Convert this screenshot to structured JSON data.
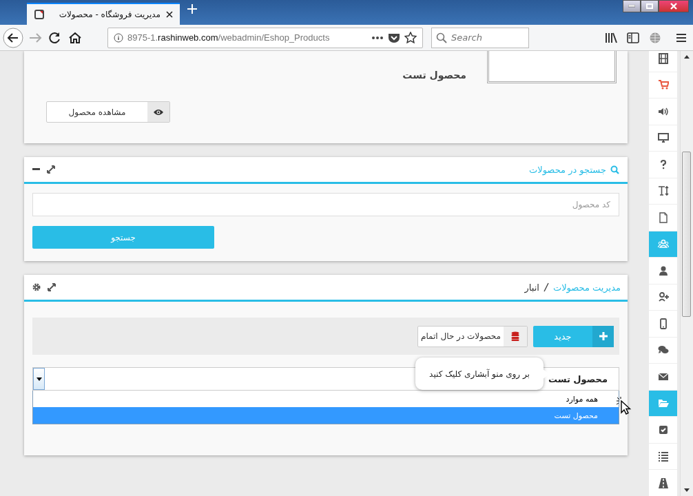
{
  "browser": {
    "tab_title": "مدیریت فروشگاه - محصولات",
    "url_host": "8975-1.",
    "url_domain": "rashinweb.com",
    "url_path": "/webadmin/Eshop_Products",
    "search_placeholder": "Search"
  },
  "product_panel": {
    "product_name": "محصول تست",
    "view_button": "مشاهده محصول"
  },
  "search_panel": {
    "title": "جستجو در محصولات",
    "code_field": {
      "placeholder": "کد محصول"
    },
    "search_button": "جستجو"
  },
  "manage_panel": {
    "breadcrumb": [
      {
        "label": "مدیریت محصولات",
        "kind": "link"
      },
      {
        "label": "انبار",
        "kind": "current"
      }
    ],
    "new_button": "جدید",
    "running_out_button": "محصولات در حال اتمام",
    "product_select": {
      "value": "محصول تست",
      "expanded": true,
      "options": [
        {
          "label": "همه موارد",
          "selected": false
        },
        {
          "label": "محصول تست",
          "selected": true
        }
      ]
    },
    "tooltip": "بر روی منو آبشاری کلیک کنید"
  },
  "sidebar": {
    "items": [
      {
        "selected": false
      },
      {
        "selected": false
      },
      {
        "selected": false
      },
      {
        "selected": false
      },
      {
        "selected": false
      },
      {
        "selected": false
      },
      {
        "selected": false
      },
      {
        "selected": true
      },
      {
        "selected": false
      },
      {
        "selected": false
      },
      {
        "selected": false
      },
      {
        "selected": false
      },
      {
        "selected": false
      },
      {
        "selected": true
      },
      {
        "selected": false
      },
      {
        "selected": false
      },
      {
        "selected": false
      }
    ]
  }
}
